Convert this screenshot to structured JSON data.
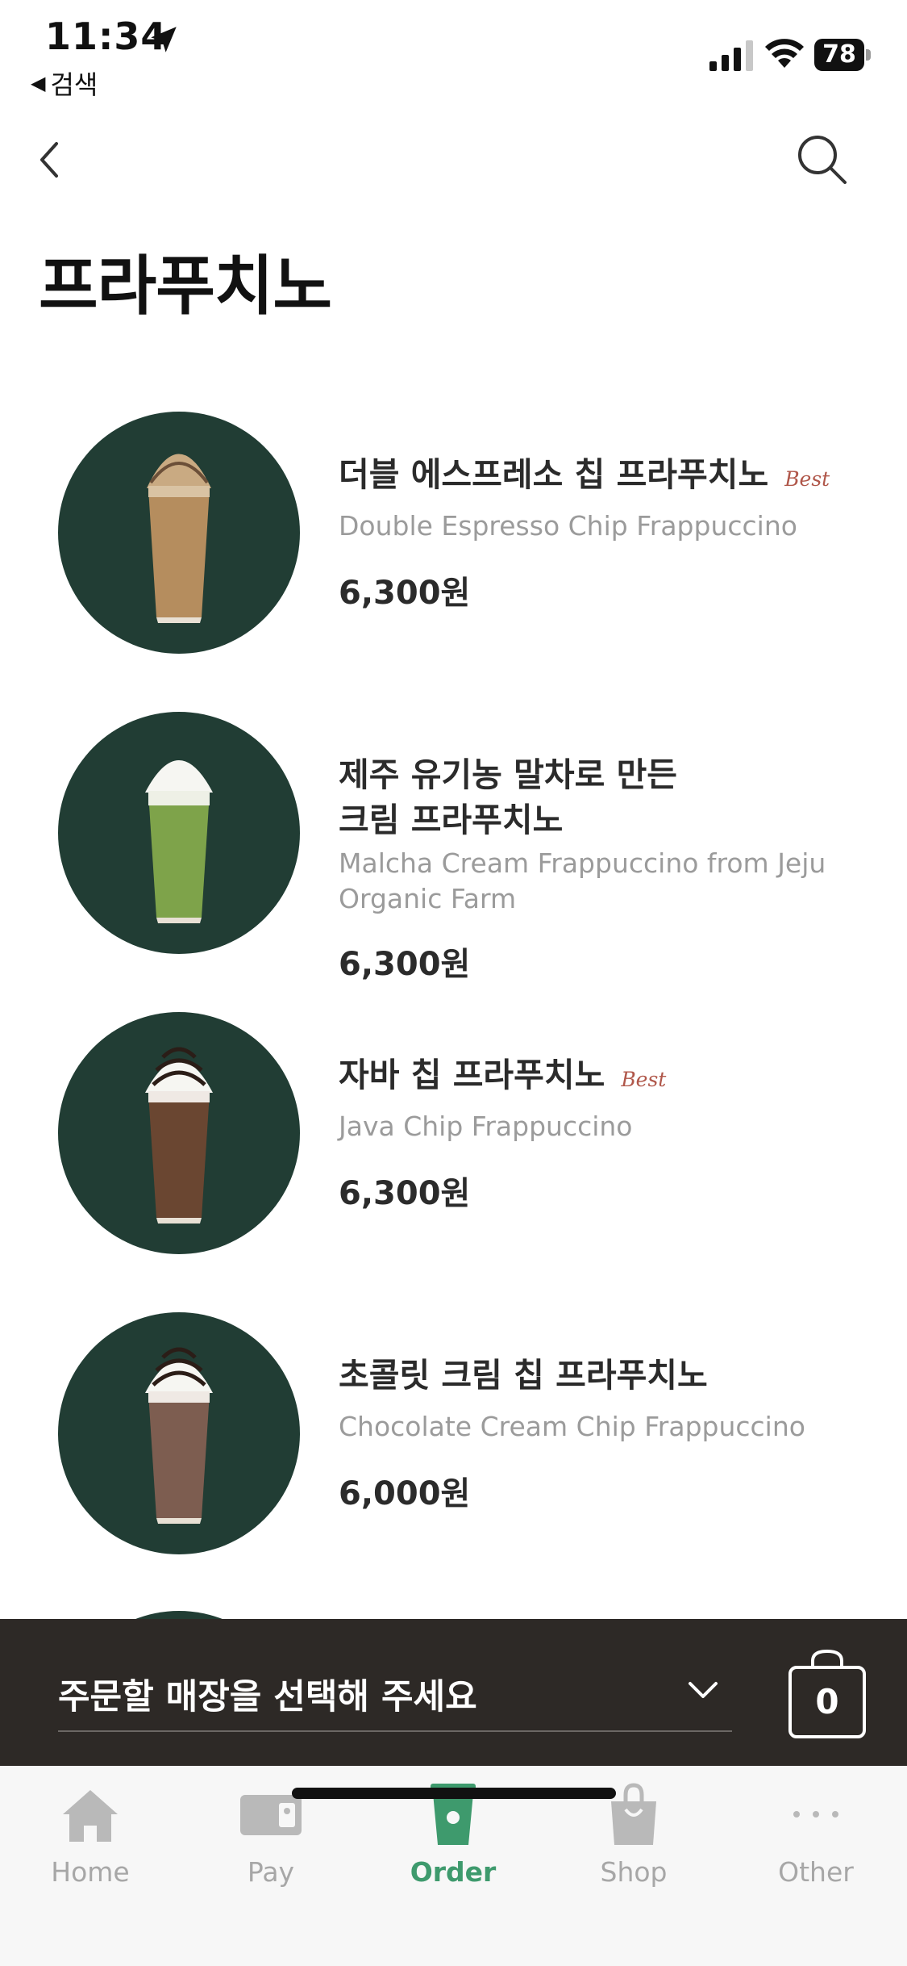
{
  "status_bar": {
    "time": "11:34",
    "back_app_label": "검색",
    "battery": "78"
  },
  "header": {
    "title": "프라푸치노"
  },
  "products": [
    {
      "name": "더블 에스프레소 칩 프라푸치노",
      "badge": "Best",
      "english_name": "Double Espresso Chip Frappuccino",
      "price": "6,300원",
      "drink_color": "#b58d5e"
    },
    {
      "name": "제주 유기농 말차로 만든\n크림 프라푸치노",
      "badge": "",
      "english_name": "Malcha Cream Frappuccino from Jeju Organic Farm",
      "price": "6,300원",
      "drink_color": "#7ea34a"
    },
    {
      "name": "자바 칩 프라푸치노",
      "badge": "Best",
      "english_name": "Java Chip Frappuccino",
      "price": "6,300원",
      "drink_color": "#6a4631"
    },
    {
      "name": "초콜릿 크림 칩 프라푸치노",
      "badge": "",
      "english_name": "Chocolate Cream Chip Frappuccino",
      "price": "6,000원",
      "drink_color": "#7d5d50"
    }
  ],
  "store_bar": {
    "label": "주문할 매장을 선택해 주세요",
    "cart_count": "0"
  },
  "tabs": [
    {
      "label": "Home",
      "icon": "home-icon",
      "active": false
    },
    {
      "label": "Pay",
      "icon": "card-icon",
      "active": false
    },
    {
      "label": "Order",
      "icon": "cup-icon",
      "active": true
    },
    {
      "label": "Shop",
      "icon": "bag-icon",
      "active": false
    },
    {
      "label": "Other",
      "icon": "more-icon",
      "active": false
    }
  ],
  "colors": {
    "brand_green": "#3e9a6d",
    "thumb_bg": "#213d34",
    "store_bar_bg": "#2d2926",
    "best_badge": "#b0574a"
  }
}
